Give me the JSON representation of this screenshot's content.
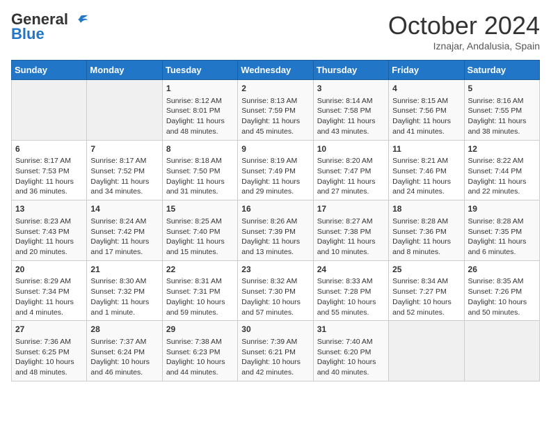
{
  "header": {
    "logo_line1": "General",
    "logo_line2": "Blue",
    "month_year": "October 2024",
    "location": "Iznajar, Andalusia, Spain"
  },
  "days_of_week": [
    "Sunday",
    "Monday",
    "Tuesday",
    "Wednesday",
    "Thursday",
    "Friday",
    "Saturday"
  ],
  "weeks": [
    [
      {
        "day": "",
        "content": ""
      },
      {
        "day": "",
        "content": ""
      },
      {
        "day": "1",
        "content": "Sunrise: 8:12 AM\nSunset: 8:01 PM\nDaylight: 11 hours and 48 minutes."
      },
      {
        "day": "2",
        "content": "Sunrise: 8:13 AM\nSunset: 7:59 PM\nDaylight: 11 hours and 45 minutes."
      },
      {
        "day": "3",
        "content": "Sunrise: 8:14 AM\nSunset: 7:58 PM\nDaylight: 11 hours and 43 minutes."
      },
      {
        "day": "4",
        "content": "Sunrise: 8:15 AM\nSunset: 7:56 PM\nDaylight: 11 hours and 41 minutes."
      },
      {
        "day": "5",
        "content": "Sunrise: 8:16 AM\nSunset: 7:55 PM\nDaylight: 11 hours and 38 minutes."
      }
    ],
    [
      {
        "day": "6",
        "content": "Sunrise: 8:17 AM\nSunset: 7:53 PM\nDaylight: 11 hours and 36 minutes."
      },
      {
        "day": "7",
        "content": "Sunrise: 8:17 AM\nSunset: 7:52 PM\nDaylight: 11 hours and 34 minutes."
      },
      {
        "day": "8",
        "content": "Sunrise: 8:18 AM\nSunset: 7:50 PM\nDaylight: 11 hours and 31 minutes."
      },
      {
        "day": "9",
        "content": "Sunrise: 8:19 AM\nSunset: 7:49 PM\nDaylight: 11 hours and 29 minutes."
      },
      {
        "day": "10",
        "content": "Sunrise: 8:20 AM\nSunset: 7:47 PM\nDaylight: 11 hours and 27 minutes."
      },
      {
        "day": "11",
        "content": "Sunrise: 8:21 AM\nSunset: 7:46 PM\nDaylight: 11 hours and 24 minutes."
      },
      {
        "day": "12",
        "content": "Sunrise: 8:22 AM\nSunset: 7:44 PM\nDaylight: 11 hours and 22 minutes."
      }
    ],
    [
      {
        "day": "13",
        "content": "Sunrise: 8:23 AM\nSunset: 7:43 PM\nDaylight: 11 hours and 20 minutes."
      },
      {
        "day": "14",
        "content": "Sunrise: 8:24 AM\nSunset: 7:42 PM\nDaylight: 11 hours and 17 minutes."
      },
      {
        "day": "15",
        "content": "Sunrise: 8:25 AM\nSunset: 7:40 PM\nDaylight: 11 hours and 15 minutes."
      },
      {
        "day": "16",
        "content": "Sunrise: 8:26 AM\nSunset: 7:39 PM\nDaylight: 11 hours and 13 minutes."
      },
      {
        "day": "17",
        "content": "Sunrise: 8:27 AM\nSunset: 7:38 PM\nDaylight: 11 hours and 10 minutes."
      },
      {
        "day": "18",
        "content": "Sunrise: 8:28 AM\nSunset: 7:36 PM\nDaylight: 11 hours and 8 minutes."
      },
      {
        "day": "19",
        "content": "Sunrise: 8:28 AM\nSunset: 7:35 PM\nDaylight: 11 hours and 6 minutes."
      }
    ],
    [
      {
        "day": "20",
        "content": "Sunrise: 8:29 AM\nSunset: 7:34 PM\nDaylight: 11 hours and 4 minutes."
      },
      {
        "day": "21",
        "content": "Sunrise: 8:30 AM\nSunset: 7:32 PM\nDaylight: 11 hours and 1 minute."
      },
      {
        "day": "22",
        "content": "Sunrise: 8:31 AM\nSunset: 7:31 PM\nDaylight: 10 hours and 59 minutes."
      },
      {
        "day": "23",
        "content": "Sunrise: 8:32 AM\nSunset: 7:30 PM\nDaylight: 10 hours and 57 minutes."
      },
      {
        "day": "24",
        "content": "Sunrise: 8:33 AM\nSunset: 7:28 PM\nDaylight: 10 hours and 55 minutes."
      },
      {
        "day": "25",
        "content": "Sunrise: 8:34 AM\nSunset: 7:27 PM\nDaylight: 10 hours and 52 minutes."
      },
      {
        "day": "26",
        "content": "Sunrise: 8:35 AM\nSunset: 7:26 PM\nDaylight: 10 hours and 50 minutes."
      }
    ],
    [
      {
        "day": "27",
        "content": "Sunrise: 7:36 AM\nSunset: 6:25 PM\nDaylight: 10 hours and 48 minutes."
      },
      {
        "day": "28",
        "content": "Sunrise: 7:37 AM\nSunset: 6:24 PM\nDaylight: 10 hours and 46 minutes."
      },
      {
        "day": "29",
        "content": "Sunrise: 7:38 AM\nSunset: 6:23 PM\nDaylight: 10 hours and 44 minutes."
      },
      {
        "day": "30",
        "content": "Sunrise: 7:39 AM\nSunset: 6:21 PM\nDaylight: 10 hours and 42 minutes."
      },
      {
        "day": "31",
        "content": "Sunrise: 7:40 AM\nSunset: 6:20 PM\nDaylight: 10 hours and 40 minutes."
      },
      {
        "day": "",
        "content": ""
      },
      {
        "day": "",
        "content": ""
      }
    ]
  ]
}
